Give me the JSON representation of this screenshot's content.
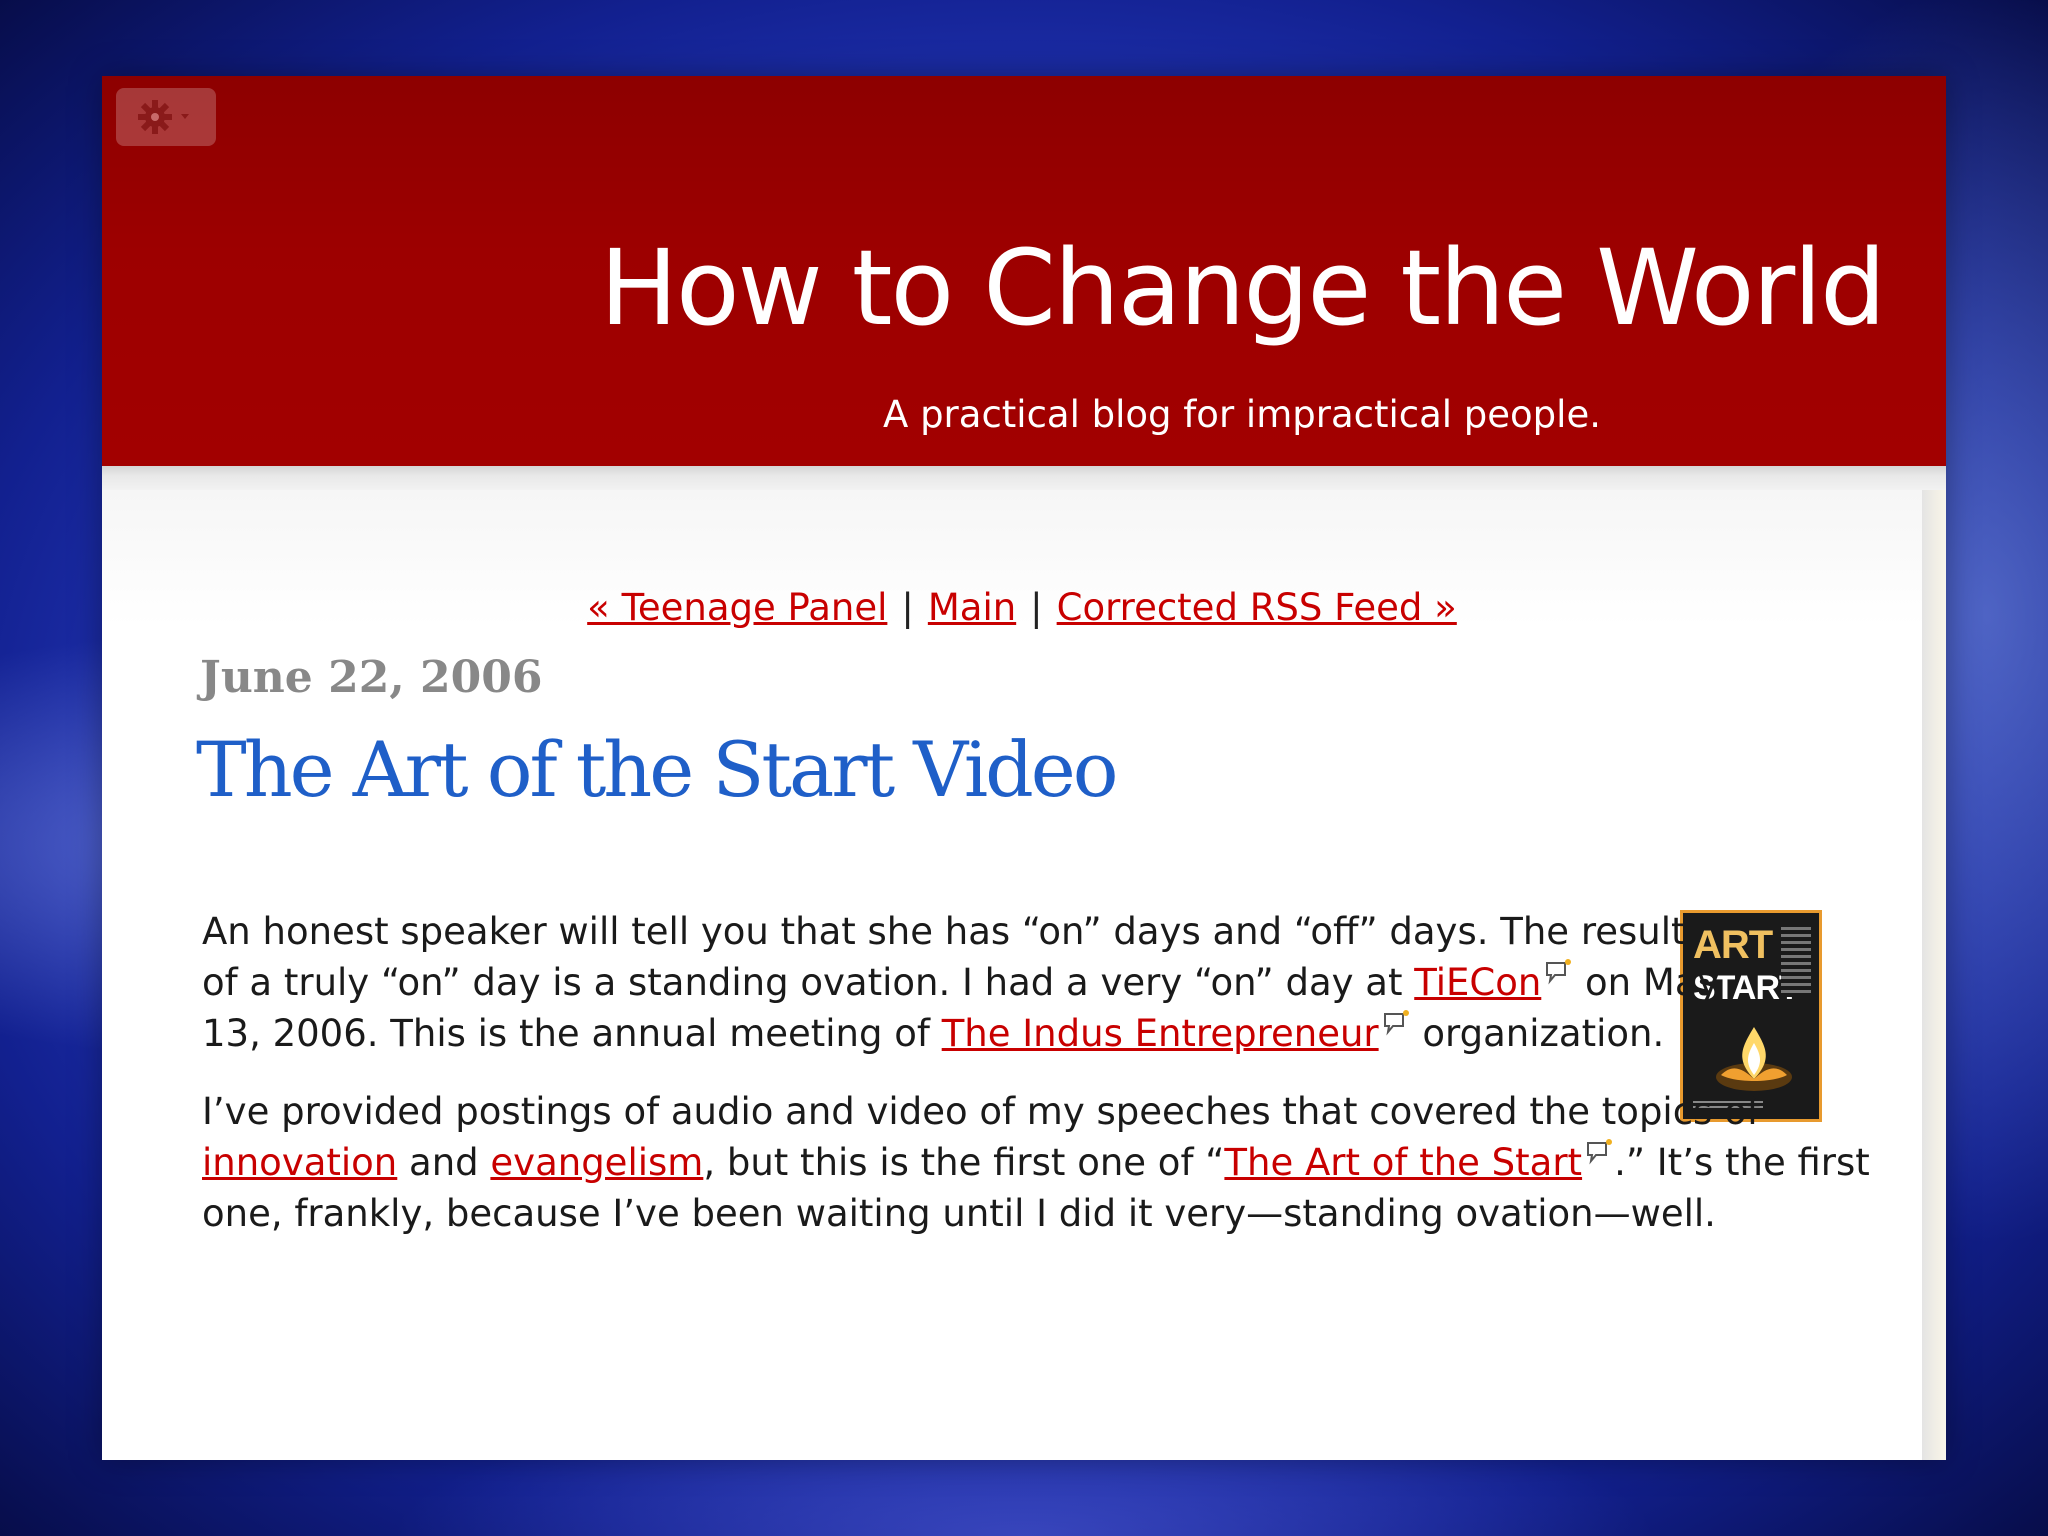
{
  "header": {
    "site_title": "How to Change the World",
    "tagline": "A practical blog for impractical people."
  },
  "nav": {
    "prev_label": "« Teenage Panel",
    "separator": "|",
    "main_label": "Main",
    "next_label": "Corrected RSS Feed »"
  },
  "post": {
    "date": "June 22, 2006",
    "title": "The Art of the Start Video",
    "p1": {
      "t1": "An honest speaker will tell you that she has “on” days and “off” days. The result of a truly “on” day is a standing ovation. I had a very “on” day at ",
      "link_tiecon": "TiECon",
      "t2": " on May 13, 2006. This is the annual meeting of ",
      "link_tie": "The Indus Entrepreneur",
      "t3": " organization."
    },
    "p2": {
      "t1": "I’ve provided postings of audio and video of my speeches that covered the topics of ",
      "link_innovation": "innovation",
      "t2": " and ",
      "link_evangelism": "evangelism",
      "t3": ", but this is the first one of “",
      "link_book": "The Art of the Start",
      "t4": ".” It’s the first one, frankly, because I’ve been waiting until I did it very—standing ovation—well."
    },
    "book_cover": {
      "line1": "ART",
      "line2": "START"
    }
  },
  "colors": {
    "header_red": "#9d0000",
    "link_red": "#c80000",
    "title_blue": "#1f5fc8",
    "date_gray": "#888888"
  },
  "icons": {
    "settings": "gear-icon",
    "annotation": "speech-bubble-icon"
  }
}
